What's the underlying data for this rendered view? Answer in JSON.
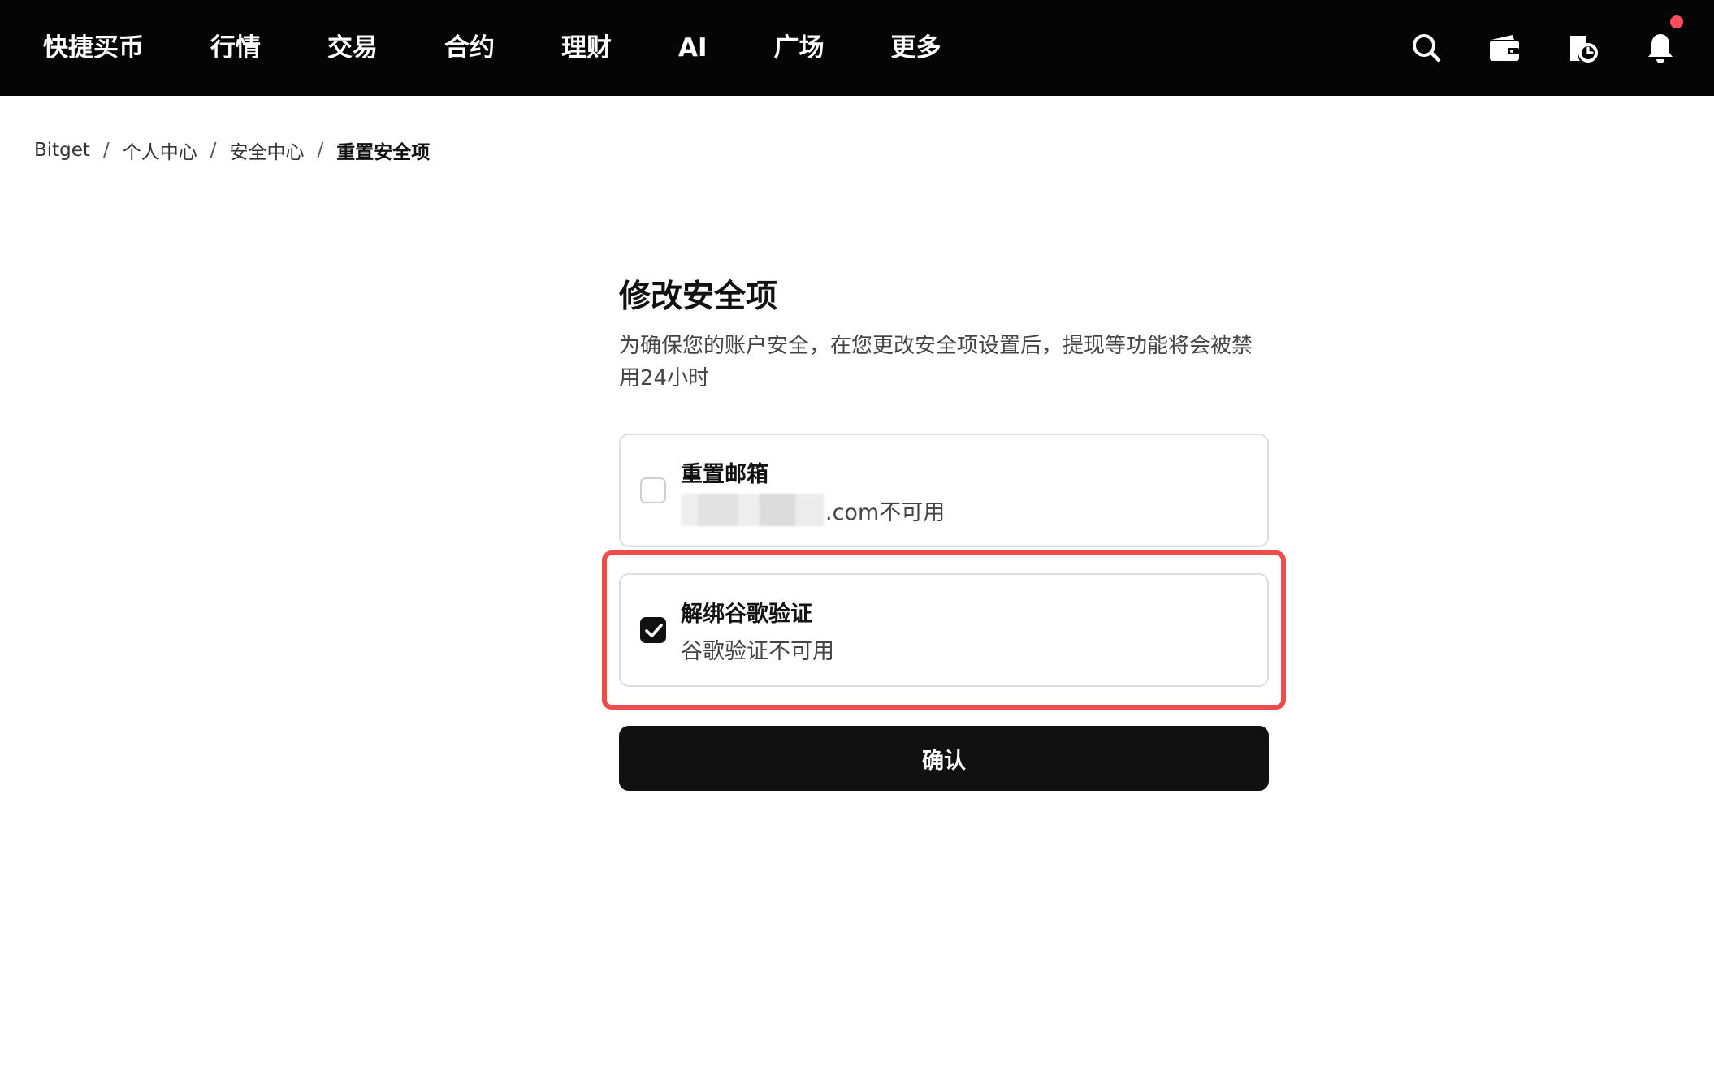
{
  "nav": {
    "items": [
      "快捷买币",
      "行情",
      "交易",
      "合约",
      "理财",
      "AI",
      "广场",
      "更多"
    ],
    "icons": [
      "search-icon",
      "wallet-icon",
      "order-history-icon",
      "bell-icon"
    ],
    "notification_dot_color": "#ff4d5e"
  },
  "breadcrumb": {
    "items": [
      "Bitget",
      "个人中心",
      "安全中心",
      "重置安全项"
    ],
    "separator": "/"
  },
  "page": {
    "title": "修改安全项",
    "description": "为确保您的账户安全，在您更改安全项设置后，提现等功能将会被禁用24小时"
  },
  "options": [
    {
      "title": "重置邮箱",
      "subtitle_suffix": ".com不可用",
      "checked": false
    },
    {
      "title": "解绑谷歌验证",
      "subtitle": "谷歌验证不可用",
      "checked": true
    }
  ],
  "confirm_label": "确认",
  "colors": {
    "topbar": "#050505",
    "highlight": "#ee4b4b",
    "button": "#111111"
  }
}
